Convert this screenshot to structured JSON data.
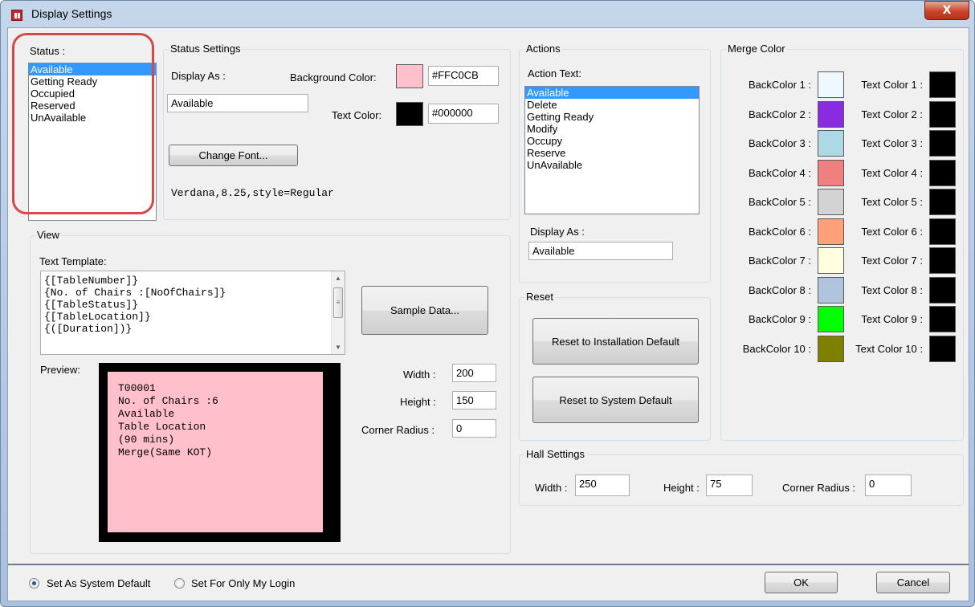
{
  "window": {
    "title": "Display Settings",
    "close_glyph": "X"
  },
  "status": {
    "label": "Status :",
    "items": [
      "Available",
      "Getting Ready",
      "Occupied",
      "Reserved",
      "UnAvailable"
    ],
    "selected": "Available"
  },
  "status_settings": {
    "label": "Status Settings",
    "display_as_label": "Display As :",
    "display_as_value": "Available",
    "background_color_label": "Background Color:",
    "background_color_hex": "#FFC0CB",
    "background_swatch": "#ffc0cb",
    "text_color_label": "Text Color:",
    "text_color_hex": "#000000",
    "text_swatch": "#000000",
    "change_font_button": "Change Font...",
    "font_info": "Verdana,8.25,style=Regular"
  },
  "actions": {
    "label": "Actions",
    "action_text_label": "Action Text:",
    "items": [
      "Available",
      "Delete",
      "Getting Ready",
      "Modify",
      "Occupy",
      "Reserve",
      "UnAvailable"
    ],
    "selected": "Available",
    "display_as_label": "Display As :",
    "display_as_value": "Available"
  },
  "merge_color": {
    "label": "Merge Color",
    "rows": [
      {
        "back_label": "BackColor 1 :",
        "back": "#f0f8ff",
        "text_label": "Text Color 1 :",
        "text": "#000000"
      },
      {
        "back_label": "BackColor 2 :",
        "back": "#8a2be2",
        "text_label": "Text Color 2 :",
        "text": "#000000"
      },
      {
        "back_label": "BackColor 3 :",
        "back": "#add8e6",
        "text_label": "Text Color 3 :",
        "text": "#000000"
      },
      {
        "back_label": "BackColor 4 :",
        "back": "#f08080",
        "text_label": "Text Color 4 :",
        "text": "#000000"
      },
      {
        "back_label": "BackColor 5 :",
        "back": "#d3d3d3",
        "text_label": "Text Color 5 :",
        "text": "#000000"
      },
      {
        "back_label": "BackColor 6 :",
        "back": "#ffa07a",
        "text_label": "Text Color 6 :",
        "text": "#000000"
      },
      {
        "back_label": "BackColor 7 :",
        "back": "#fffde0",
        "text_label": "Text Color 7 :",
        "text": "#000000"
      },
      {
        "back_label": "BackColor 8 :",
        "back": "#b0c4de",
        "text_label": "Text Color 8 :",
        "text": "#000000"
      },
      {
        "back_label": "BackColor 9 :",
        "back": "#00ff00",
        "text_label": "Text Color 9 :",
        "text": "#000000"
      },
      {
        "back_label": "BackColor 10 :",
        "back": "#808000",
        "text_label": "Text Color 10 :",
        "text": "#000000"
      }
    ]
  },
  "view": {
    "label": "View",
    "text_template_label": "Text Template:",
    "template_lines": [
      "{[TableNumber]}",
      "{No. of Chairs :[NoOfChairs]}",
      "{[TableStatus]}",
      "{[TableLocation]}",
      "{([Duration])}"
    ],
    "sample_data_button": "Sample Data...",
    "preview_label": "Preview:",
    "preview_lines": [
      "T00001",
      "No. of Chairs :6",
      "Available",
      "Table Location",
      "(90 mins)",
      "Merge(Same KOT)"
    ],
    "preview_bg": "#ffc0cb",
    "width_label": "Width :",
    "width_value": "200",
    "height_label": "Height :",
    "height_value": "150",
    "corner_radius_label": "Corner Radius :",
    "corner_radius_value": "0"
  },
  "reset": {
    "label": "Reset",
    "installation_default_button": "Reset to Installation Default",
    "system_default_button": "Reset to System Default"
  },
  "hall_settings": {
    "label": "Hall Settings",
    "width_label": "Width :",
    "width_value": "250",
    "height_label": "Height :",
    "height_value": "75",
    "corner_radius_label": "Corner Radius :",
    "corner_radius_value": "0"
  },
  "footer": {
    "radio_system_default": "Set As System Default",
    "radio_my_login": "Set For Only My Login",
    "selected": "Set As System Default",
    "ok_button": "OK",
    "cancel_button": "Cancel"
  }
}
